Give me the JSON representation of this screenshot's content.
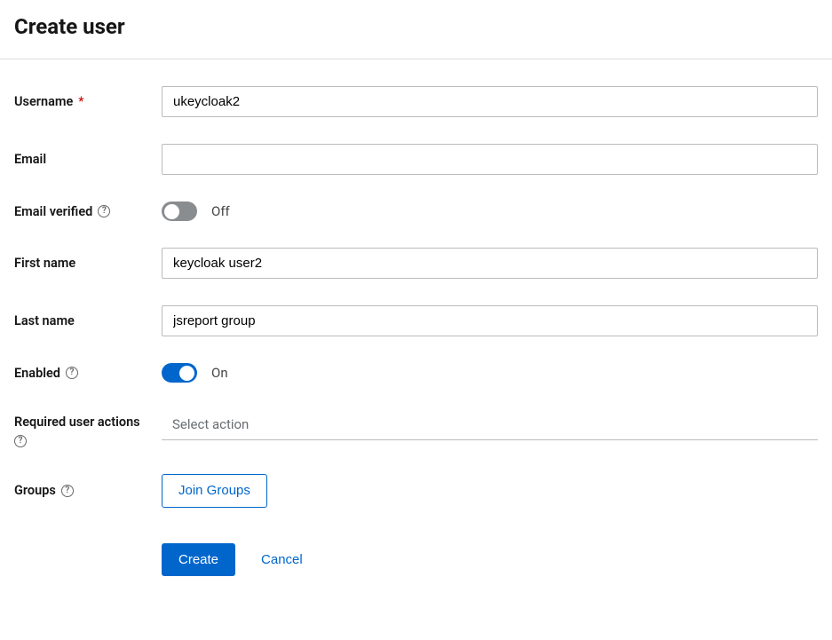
{
  "page": {
    "title": "Create user"
  },
  "labels": {
    "username": "Username",
    "email": "Email",
    "emailVerified": "Email verified",
    "firstName": "First name",
    "lastName": "Last name",
    "enabled": "Enabled",
    "requiredActions": "Required user actions",
    "groups": "Groups"
  },
  "values": {
    "username": "ukeycloak2",
    "email": "",
    "emailVerified": false,
    "emailVerifiedText": "Off",
    "firstName": "keycloak user2",
    "lastName": "jsreport group",
    "enabled": true,
    "enabledText": "On",
    "requiredActionsPlaceholder": "Select action"
  },
  "buttons": {
    "joinGroups": "Join Groups",
    "create": "Create",
    "cancel": "Cancel"
  }
}
